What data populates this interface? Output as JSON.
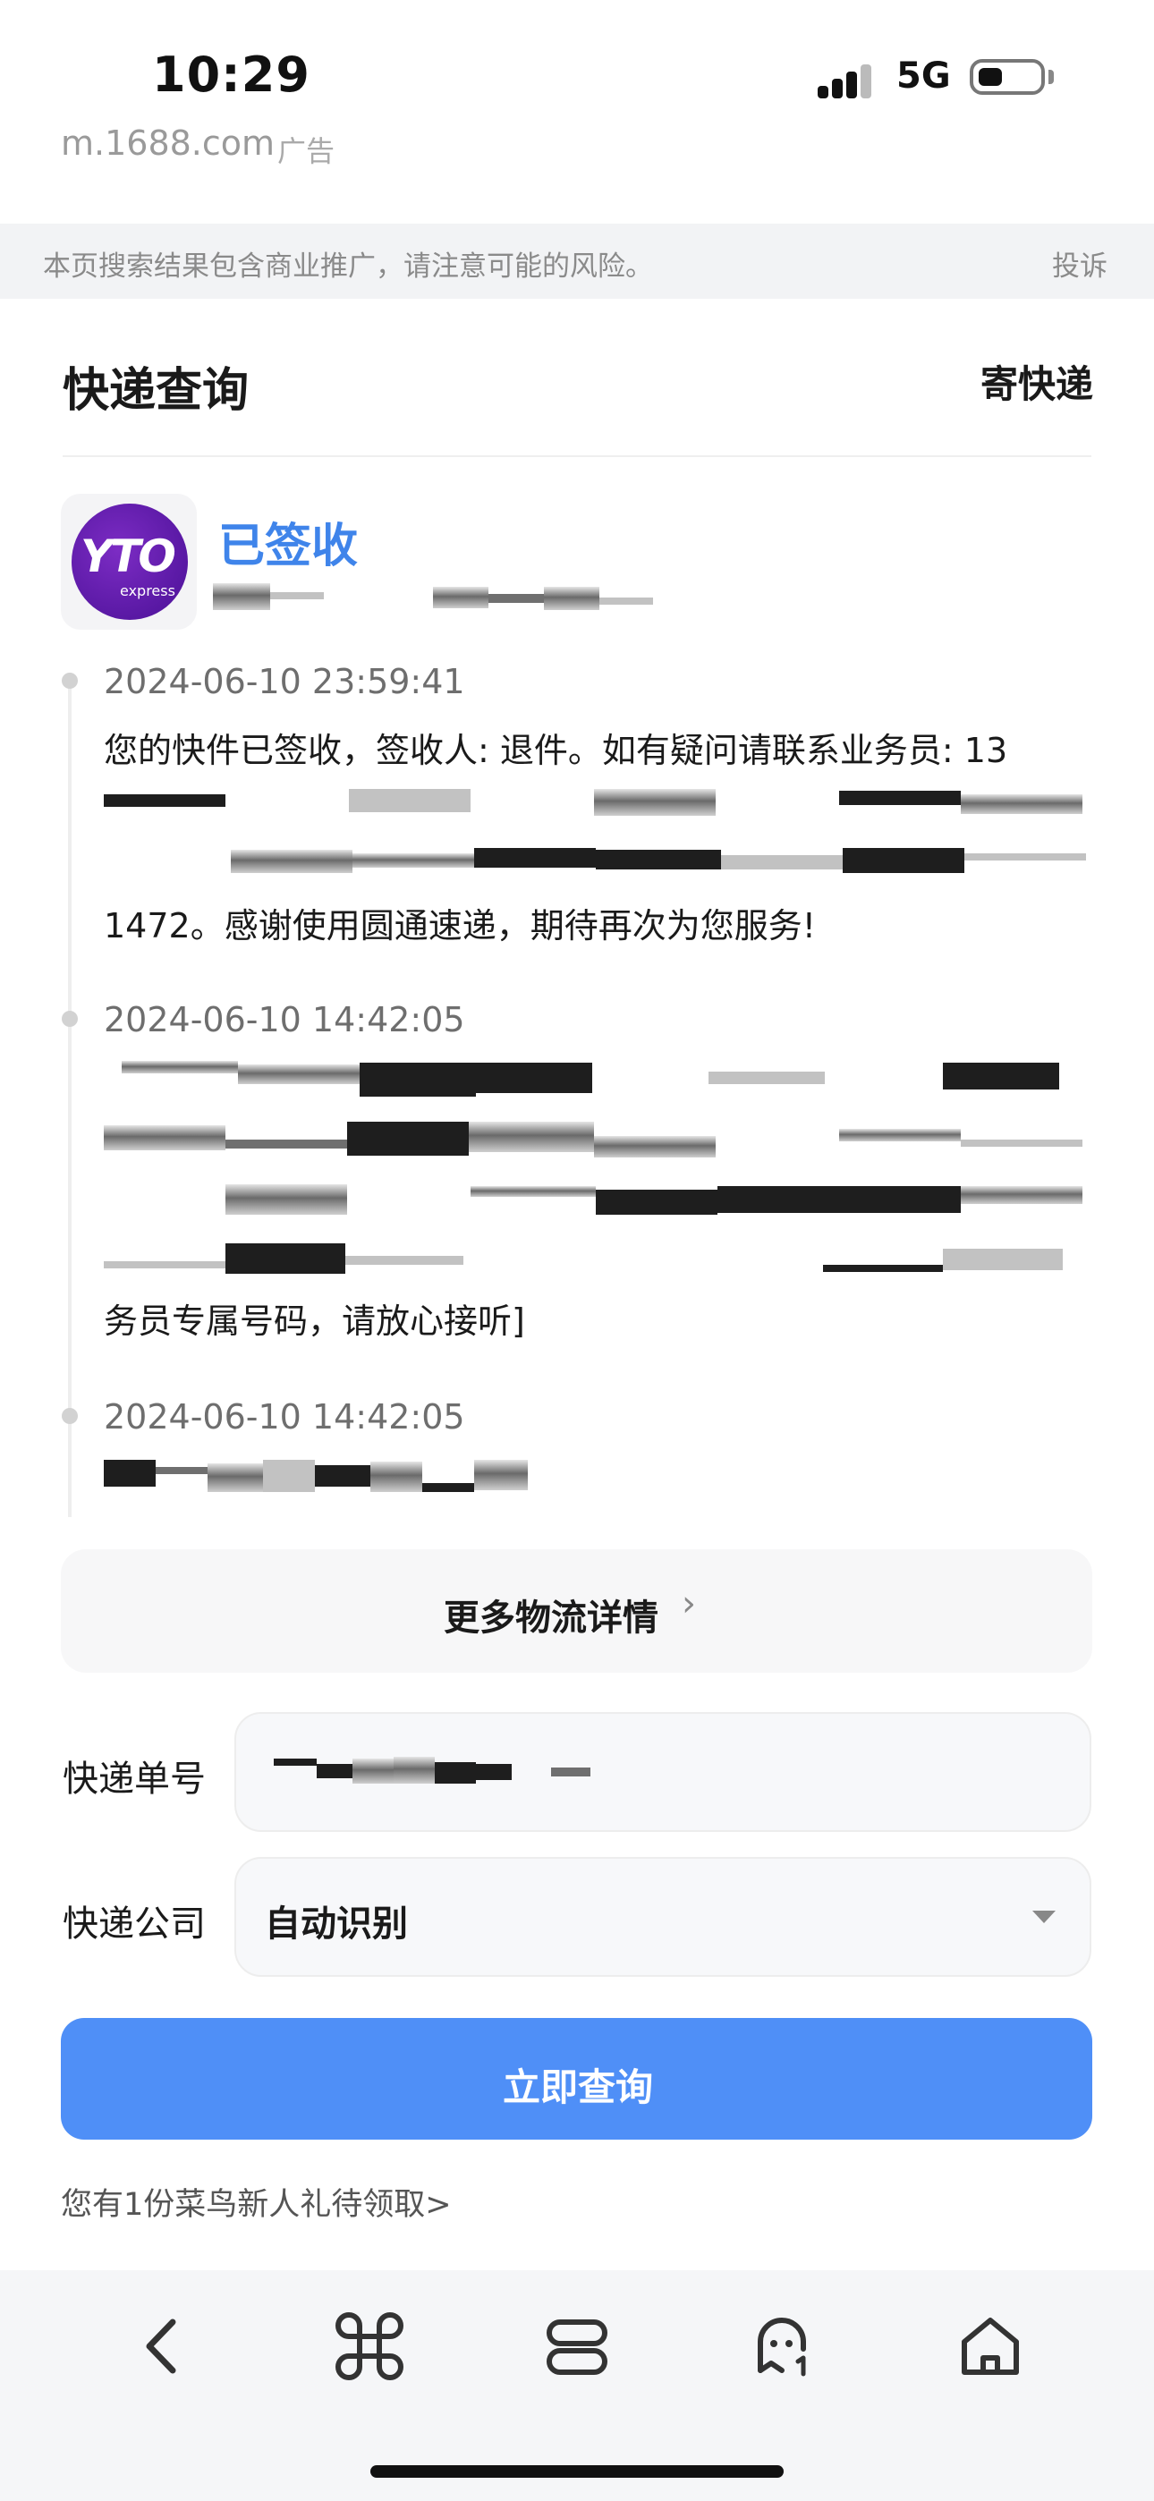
{
  "status_bar": {
    "time": "10:29",
    "network": "5G",
    "url": "m.1688.com",
    "ad_tag": "广告"
  },
  "notice": {
    "text": "本页搜索结果包含商业推广，请注意可能的风险。",
    "report_label": "投诉"
  },
  "header": {
    "title": "快递查询",
    "send_label": "寄快递"
  },
  "carrier": {
    "logo_text": "YTO",
    "logo_subtext": "express",
    "status": "已签收"
  },
  "timeline": [
    {
      "time": "2024-06-10 23:59:41",
      "line1": "您的快件已签收，签收人: 退件。如有疑问请联系业务员: 13",
      "line2": "1472。感谢使用圆通速递，期待再次为您服务!"
    },
    {
      "time": "2024-06-10 14:42:05",
      "line_end": "务员专属号码，请放心接听]"
    },
    {
      "time": "2024-06-10 14:42:05"
    }
  ],
  "more": {
    "label": "更多物流详情",
    "chevron": "›"
  },
  "form": {
    "tracking_label": "快递单号",
    "company_label": "快递公司",
    "company_value": "自动识别",
    "submit_label": "立即查询"
  },
  "gift_link": "您有1份菜鸟新人礼待领取>",
  "nav_icons": [
    "back-icon",
    "command-icon",
    "tabs-icon",
    "ghost-icon",
    "home-icon"
  ],
  "colors": {
    "accent": "#4f8ff7",
    "status_blue": "#3f84ea",
    "logo_purple": "#5a17a8",
    "logo_pink": "#e63cc4"
  }
}
